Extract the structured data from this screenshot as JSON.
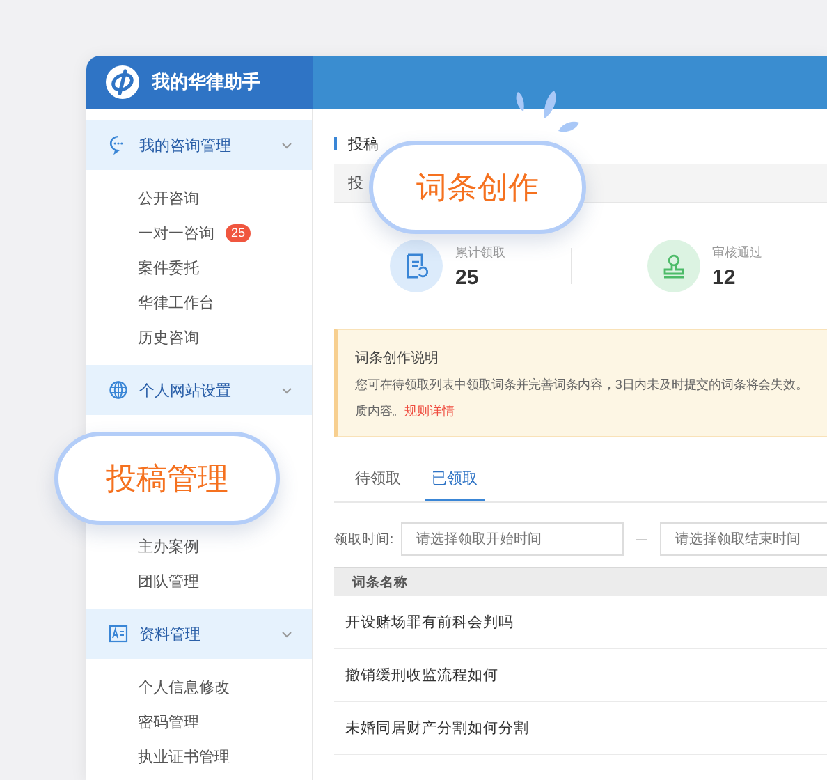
{
  "app": {
    "title": "我的华律助手"
  },
  "sidebar": {
    "groups": [
      {
        "label": "我的咨询管理",
        "items": [
          {
            "label": "公开咨询"
          },
          {
            "label": "一对一咨询",
            "badge": "25"
          },
          {
            "label": "案件委托"
          },
          {
            "label": "华律工作台"
          },
          {
            "label": "历史咨询"
          }
        ]
      },
      {
        "label": "个人网站设置",
        "items": [
          {
            "label": "主办案例"
          },
          {
            "label": "团队管理"
          }
        ]
      },
      {
        "label": "资料管理",
        "items": [
          {
            "label": "个人信息修改"
          },
          {
            "label": "密码管理"
          },
          {
            "label": "执业证书管理"
          }
        ]
      }
    ]
  },
  "content": {
    "breadcrumb": "投稿",
    "tab_bar": {
      "label": "投"
    },
    "stats": [
      {
        "label": "累计领取",
        "value": "25"
      },
      {
        "label": "审核通过",
        "value": "12"
      }
    ],
    "notice": {
      "title": "词条创作说明",
      "text": "您可在待领取列表中领取词条并完善词条内容，3日内未及时提交的词条将会失效。",
      "text_2": "质内容。",
      "link": "规则详情"
    },
    "tabs": [
      {
        "label": "待领取",
        "selected": false
      },
      {
        "label": "已领取",
        "selected": true
      }
    ],
    "filter": {
      "label": "领取时间:",
      "start_placeholder": "请选择领取开始时间",
      "end_placeholder": "请选择领取结束时间"
    },
    "table": {
      "columns": [
        "词条名称"
      ],
      "rows": [
        [
          "开设赌场罪有前科会判吗"
        ],
        [
          "撤销缓刑收监流程如何"
        ],
        [
          "未婚同居财产分割如何分割"
        ]
      ]
    }
  },
  "callouts": [
    {
      "text": "词条创作",
      "splash": true
    },
    {
      "text": "投稿管理",
      "splash": false
    }
  ]
}
